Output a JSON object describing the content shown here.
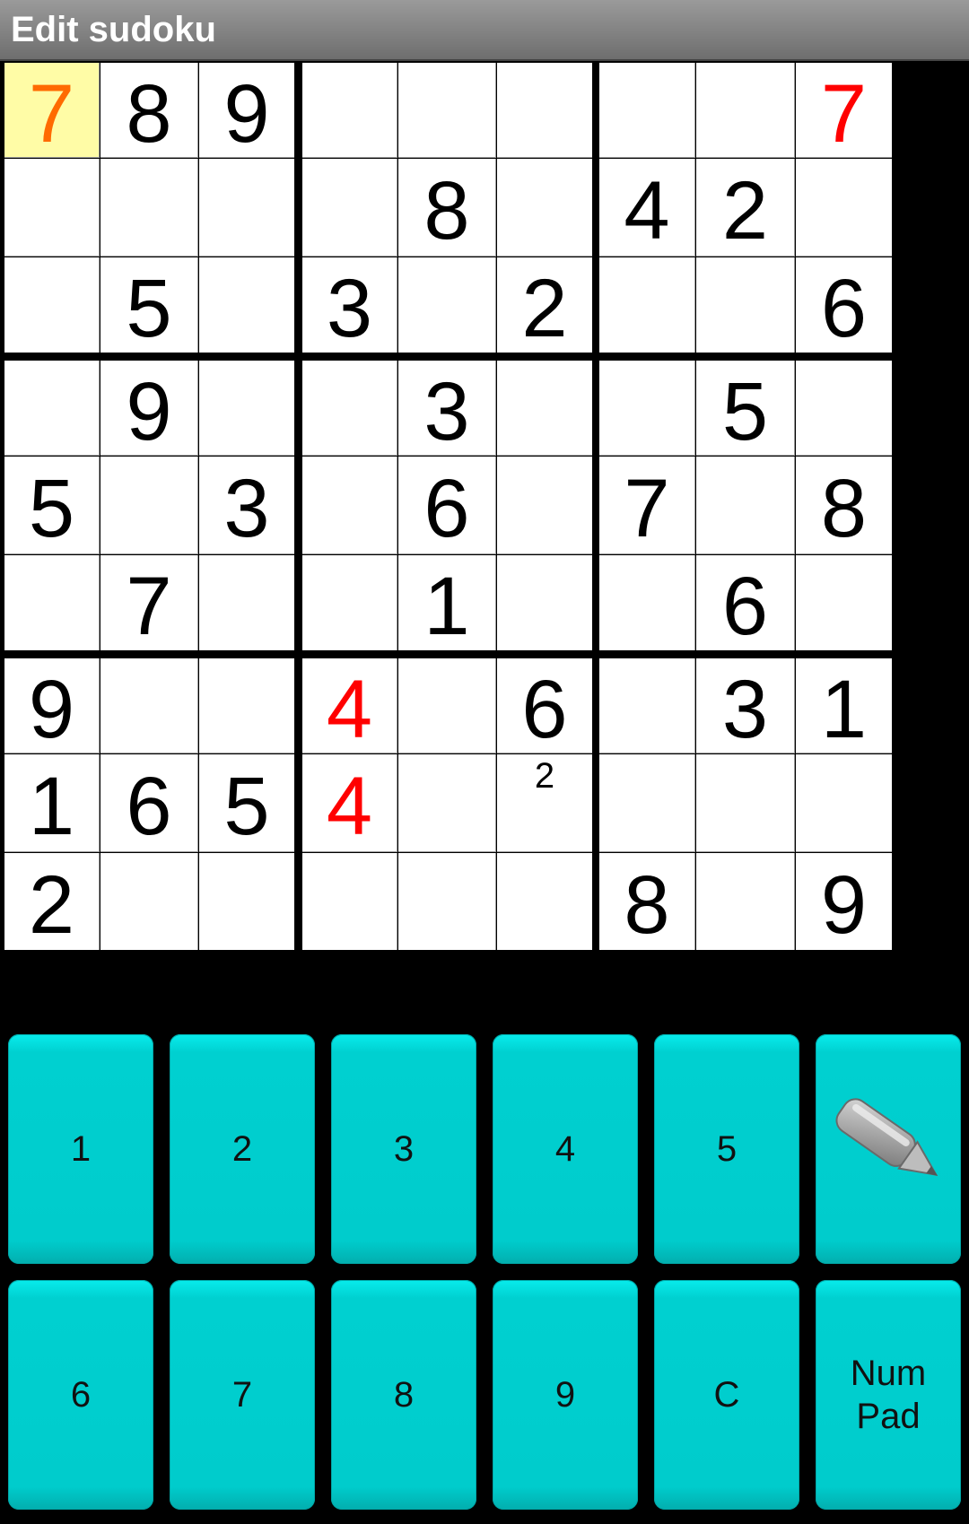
{
  "header": {
    "title": "Edit sudoku"
  },
  "colors": {
    "selected_background": "#fffca6",
    "selected_digit": "#ff6a00",
    "conflict_digit": "#ff0000",
    "given_digit": "#000000",
    "key_color": "#00cccc"
  },
  "board": {
    "selected_cell": [
      0,
      0
    ],
    "rows": [
      [
        {
          "v": "7",
          "c": "selected"
        },
        {
          "v": "8"
        },
        {
          "v": "9"
        },
        {
          "v": ""
        },
        {
          "v": ""
        },
        {
          "v": ""
        },
        {
          "v": ""
        },
        {
          "v": ""
        },
        {
          "v": "7",
          "c": "conflict"
        }
      ],
      [
        {
          "v": ""
        },
        {
          "v": ""
        },
        {
          "v": ""
        },
        {
          "v": ""
        },
        {
          "v": "8"
        },
        {
          "v": ""
        },
        {
          "v": "4"
        },
        {
          "v": "2"
        },
        {
          "v": ""
        }
      ],
      [
        {
          "v": ""
        },
        {
          "v": "5"
        },
        {
          "v": ""
        },
        {
          "v": "3"
        },
        {
          "v": ""
        },
        {
          "v": "2"
        },
        {
          "v": ""
        },
        {
          "v": ""
        },
        {
          "v": "6"
        }
      ],
      [
        {
          "v": ""
        },
        {
          "v": "9"
        },
        {
          "v": ""
        },
        {
          "v": ""
        },
        {
          "v": "3"
        },
        {
          "v": ""
        },
        {
          "v": ""
        },
        {
          "v": "5"
        },
        {
          "v": ""
        }
      ],
      [
        {
          "v": "5"
        },
        {
          "v": ""
        },
        {
          "v": "3"
        },
        {
          "v": ""
        },
        {
          "v": "6"
        },
        {
          "v": ""
        },
        {
          "v": "7"
        },
        {
          "v": ""
        },
        {
          "v": "8"
        }
      ],
      [
        {
          "v": ""
        },
        {
          "v": "7"
        },
        {
          "v": ""
        },
        {
          "v": ""
        },
        {
          "v": "1"
        },
        {
          "v": ""
        },
        {
          "v": ""
        },
        {
          "v": "6"
        },
        {
          "v": ""
        }
      ],
      [
        {
          "v": "9"
        },
        {
          "v": ""
        },
        {
          "v": ""
        },
        {
          "v": "4",
          "c": "conflict"
        },
        {
          "v": ""
        },
        {
          "v": "6"
        },
        {
          "v": ""
        },
        {
          "v": "3"
        },
        {
          "v": "1"
        }
      ],
      [
        {
          "v": "1"
        },
        {
          "v": "6"
        },
        {
          "v": "5"
        },
        {
          "v": "4",
          "c": "conflict"
        },
        {
          "v": ""
        },
        {
          "v": "",
          "p": "2"
        },
        {
          "v": ""
        },
        {
          "v": ""
        },
        {
          "v": ""
        }
      ],
      [
        {
          "v": "2"
        },
        {
          "v": ""
        },
        {
          "v": ""
        },
        {
          "v": ""
        },
        {
          "v": ""
        },
        {
          "v": ""
        },
        {
          "v": "8"
        },
        {
          "v": ""
        },
        {
          "v": "9"
        }
      ]
    ]
  },
  "keypad": {
    "row1": [
      {
        "label": "1",
        "name": "key-1"
      },
      {
        "label": "2",
        "name": "key-2"
      },
      {
        "label": "3",
        "name": "key-3"
      },
      {
        "label": "4",
        "name": "key-4"
      },
      {
        "label": "5",
        "name": "key-5"
      },
      {
        "label": "",
        "name": "pencil-mode-button",
        "icon": "pencil-icon"
      }
    ],
    "row2": [
      {
        "label": "6",
        "name": "key-6"
      },
      {
        "label": "7",
        "name": "key-7"
      },
      {
        "label": "8",
        "name": "key-8"
      },
      {
        "label": "9",
        "name": "key-9"
      },
      {
        "label": "C",
        "name": "clear-button"
      },
      {
        "label": "Num\nPad",
        "name": "numpad-toggle-button"
      }
    ]
  }
}
